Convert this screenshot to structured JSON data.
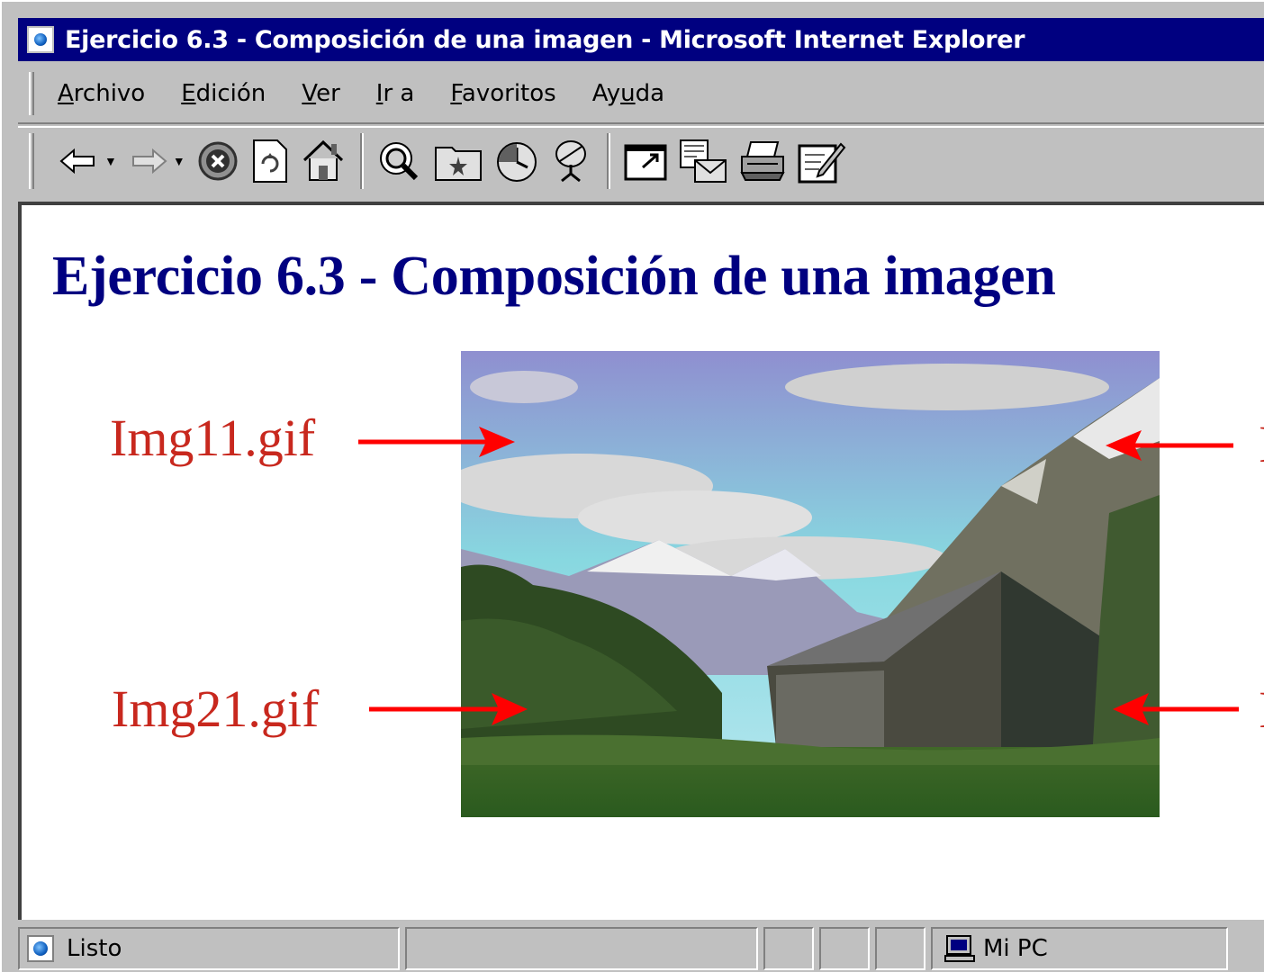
{
  "window": {
    "title": "Ejercicio 6.3 - Composición de una imagen - Microsoft Internet Explorer"
  },
  "menu": {
    "items": [
      {
        "label_pre": "",
        "label_ul": "A",
        "label_post": "rchivo"
      },
      {
        "label_pre": "",
        "label_ul": "E",
        "label_post": "dición"
      },
      {
        "label_pre": "",
        "label_ul": "V",
        "label_post": "er"
      },
      {
        "label_pre": "",
        "label_ul": "I",
        "label_post": "r a"
      },
      {
        "label_pre": "",
        "label_ul": "F",
        "label_post": "avoritos"
      },
      {
        "label_pre": "Ay",
        "label_ul": "u",
        "label_post": "da"
      }
    ]
  },
  "toolbar": {
    "buttons": [
      "back-arrow-icon",
      "forward-arrow-icon",
      "stop-icon",
      "refresh-icon",
      "home-icon",
      "search-icon",
      "favorites-icon",
      "history-icon",
      "channels-icon",
      "fullscreen-icon",
      "mail-icon",
      "print-icon",
      "edit-icon"
    ]
  },
  "page": {
    "heading": "Ejercicio 6.3 - Composición de una imagen",
    "labels": {
      "img11": "Img11.gif",
      "img21": "Img21.gif",
      "right_top": "I",
      "right_bottom": "I"
    },
    "colors": {
      "heading": "#000080",
      "label": "#c8281e",
      "arrow": "#ff0000"
    }
  },
  "status": {
    "text": "Listo",
    "zone": "Mi PC"
  }
}
